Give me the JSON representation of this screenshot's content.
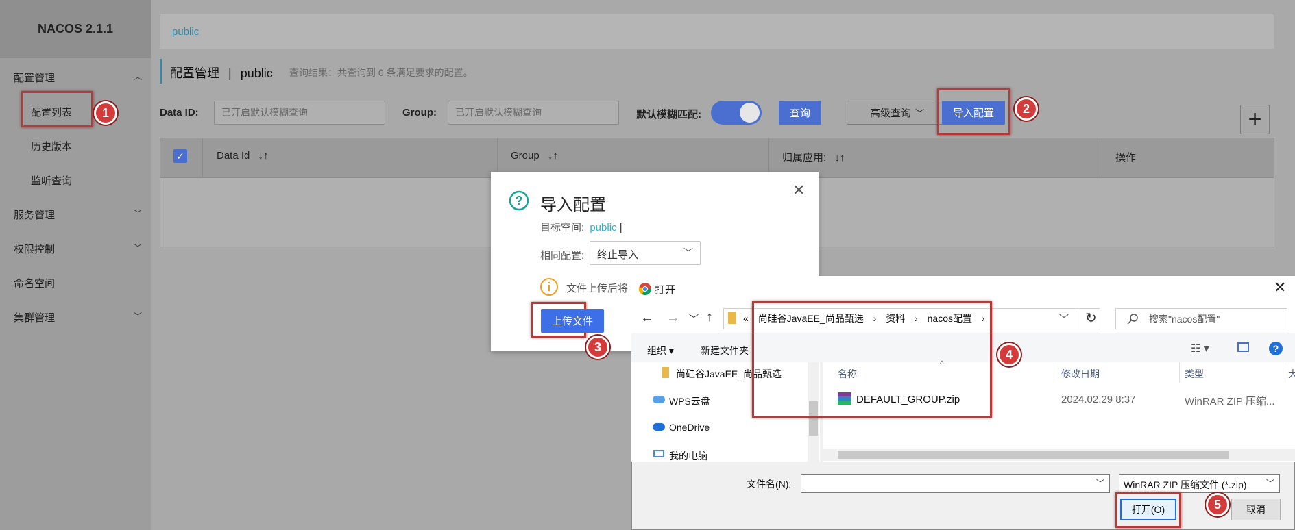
{
  "brand": "NACOS 2.1.1",
  "sidebar": {
    "items": [
      {
        "label": "配置管理"
      },
      {
        "label": "配置列表"
      },
      {
        "label": "历史版本"
      },
      {
        "label": "监听查询"
      },
      {
        "label": "服务管理"
      },
      {
        "label": "权限控制"
      },
      {
        "label": "命名空间"
      },
      {
        "label": "集群管理"
      }
    ]
  },
  "namespace_crumb": "public",
  "page": {
    "title": "配置管理",
    "separator": "|",
    "namespace": "public",
    "result_text": "查询结果：共查询到 0 条满足要求的配置。"
  },
  "filters": {
    "dataid_label": "Data ID:",
    "dataid_placeholder": "已开启默认模糊查询",
    "group_label": "Group:",
    "group_placeholder": "已开启默认模糊查询",
    "fuzzy_label": "默认模糊匹配:",
    "query_button": "查询",
    "advanced_button": "高级查询",
    "import_button": "导入配置",
    "add_button": "+"
  },
  "table": {
    "columns": [
      "Data Id",
      "Group",
      "归属应用:",
      "操作"
    ],
    "sort_glyph": "↓↑"
  },
  "import_modal": {
    "title": "导入配置",
    "target_label": "目标空间:",
    "target_value": "public",
    "same_label": "相同配置:",
    "same_value": "终止导入",
    "warning_text": "文件上传后将",
    "upload_button": "上传文件"
  },
  "file_dialog": {
    "title": "打开",
    "path": [
      "«",
      "尚硅谷JavaEE_尚品甄选",
      "资料",
      "nacos配置"
    ],
    "search_placeholder": "搜索\"nacos配置\"",
    "toolbar": {
      "organize": "组织 ▾",
      "new_folder": "新建文件夹"
    },
    "nav_items": [
      "尚硅谷JavaEE_尚品甄选",
      "WPS云盘",
      "OneDrive",
      "我的电脑"
    ],
    "columns": [
      "名称",
      "修改日期",
      "类型",
      "大"
    ],
    "files": [
      {
        "name": "DEFAULT_GROUP.zip",
        "date": "2024.02.29 8:37",
        "type": "WinRAR ZIP 压缩..."
      }
    ],
    "filename_label": "文件名(N):",
    "filetype": "WinRAR ZIP 压缩文件 (*.zip)",
    "open_button": "打开(O)",
    "cancel_button": "取消"
  },
  "badges": [
    "1",
    "2",
    "3",
    "4",
    "5"
  ],
  "colors": {
    "accent": "#4a6fd0",
    "badge": "#d43b3b",
    "highlight_box": "#b43b3b",
    "crumb_link": "#2a8bb0",
    "help_icon": "#1aa394",
    "warning_icon": "#f0a020"
  }
}
